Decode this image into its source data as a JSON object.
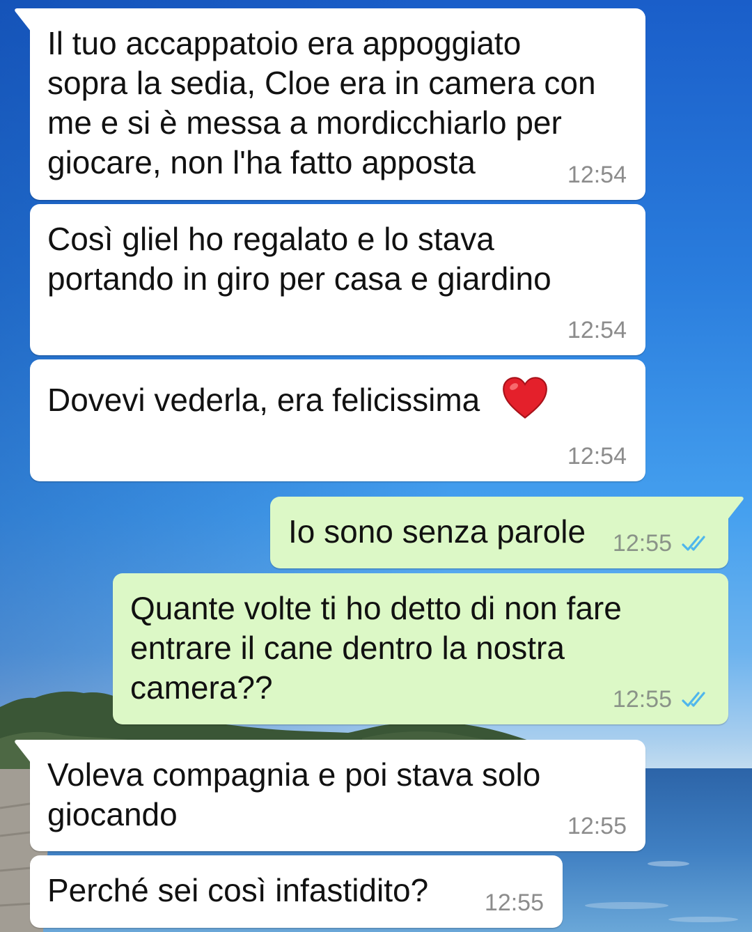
{
  "chat": {
    "messages": [
      {
        "text": "Il tuo accappatoio era appoggiato sopra la sedia, Cloe era in camera con me e si è messa a mordicchiarlo per giocare, non l'ha fatto apposta",
        "time": "12:54"
      },
      {
        "text": "Così gliel ho regalato e lo stava portando in giro per casa e giardino",
        "time": "12:54"
      },
      {
        "text": "Dovevi vederla, era felicissima",
        "emoji": "red-heart",
        "time": "12:54"
      },
      {
        "text": "Io sono senza parole",
        "time": "12:55",
        "status_icon": "double-check-read"
      },
      {
        "text": "Quante volte ti ho detto di non fare entrare il cane dentro la nostra camera??",
        "time": "12:55",
        "status_icon": "double-check-read"
      },
      {
        "text": "Voleva compagnia e poi stava solo giocando",
        "time": "12:55"
      },
      {
        "text": "Perché sei così infastidito?",
        "time": "12:55"
      }
    ]
  },
  "colors": {
    "incoming_bubble": "#ffffff",
    "outgoing_bubble": "#dcf8c6",
    "timestamp": "#8c8c8c",
    "text": "#111111",
    "read_check": "#4fb6ec"
  }
}
